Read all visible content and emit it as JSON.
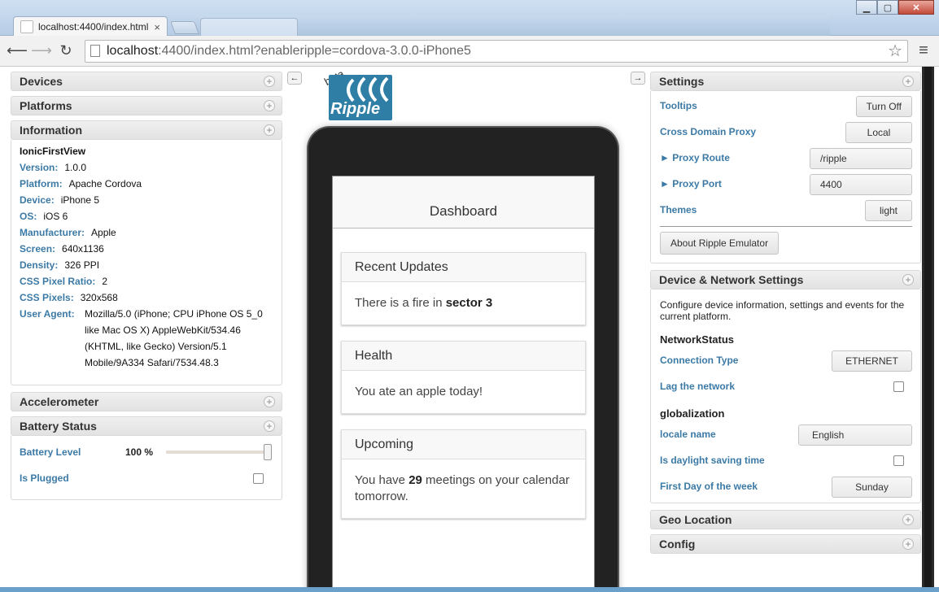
{
  "browser": {
    "tab_title": "localhost:4400/index.html",
    "faded_tab_title": "",
    "url_host": "localhost",
    "url_path": ":4400/index.html?enableripple=cordova-3.0.0-iPhone5"
  },
  "left": {
    "devices": "Devices",
    "platforms": "Platforms",
    "information": "Information",
    "app_name": "IonicFirstView",
    "info": [
      {
        "key": "Version:",
        "value": "1.0.0"
      },
      {
        "key": "Platform:",
        "value": "Apache Cordova"
      },
      {
        "key": "Device:",
        "value": "iPhone 5"
      },
      {
        "key": "OS:",
        "value": "iOS 6"
      },
      {
        "key": "Manufacturer:",
        "value": "Apple"
      },
      {
        "key": "Screen:",
        "value": "640x1136"
      },
      {
        "key": "Density:",
        "value": "326 PPI"
      },
      {
        "key": "CSS Pixel Ratio:",
        "value": "2"
      },
      {
        "key": "CSS Pixels:",
        "value": "320x568"
      }
    ],
    "user_agent_key": "User Agent:",
    "user_agent": [
      "Mozilla/5.0 (iPhone; CPU iPhone OS 5_0",
      "like Mac OS X) AppleWebKit/534.46",
      "(KHTML, like Gecko) Version/5.1",
      "Mobile/9A334 Safari/7534.48.3"
    ],
    "accelerometer": "Accelerometer",
    "battery_status": "Battery Status",
    "battery_level_label": "Battery Level",
    "battery_level_value": "100 %",
    "battery_level_fraction": 1.0,
    "is_plugged_label": "Is Plugged"
  },
  "center": {
    "logo_beta": "beta",
    "logo_text": "Ripple",
    "app_title": "Dashboard",
    "cards": [
      {
        "title": "Recent Updates",
        "body_pre": "There is a fire in ",
        "body_bold": "sector 3",
        "body_post": ""
      },
      {
        "title": "Health",
        "body_pre": "You ate an apple today!",
        "body_bold": "",
        "body_post": ""
      },
      {
        "title": "Upcoming",
        "body_pre": "You have ",
        "body_bold": "29",
        "body_post": " meetings on your calendar tomorrow."
      }
    ]
  },
  "right": {
    "settings": "Settings",
    "tooltips_label": "Tooltips",
    "tooltips_btn": "Turn Off",
    "cdp_label": "Cross Domain Proxy",
    "cdp_value": "Local",
    "proxy_route_label": "► Proxy Route",
    "proxy_route_value": "/ripple",
    "proxy_port_label": "► Proxy Port",
    "proxy_port_value": "4400",
    "themes_label": "Themes",
    "themes_value": "light",
    "about_btn": "About Ripple Emulator",
    "device_network": "Device & Network Settings",
    "device_network_desc": "Configure device information, settings and events for the current platform.",
    "network_status": "NetworkStatus",
    "connection_type_label": "Connection Type",
    "connection_type_value": "ETHERNET",
    "lag_label": "Lag the network",
    "globalization": "globalization",
    "locale_label": "locale name",
    "locale_value": "English",
    "dst_label": "Is daylight saving time",
    "first_day_label": "First Day of the week",
    "first_day_value": "Sunday",
    "geo": "Geo Location",
    "config": "Config"
  }
}
